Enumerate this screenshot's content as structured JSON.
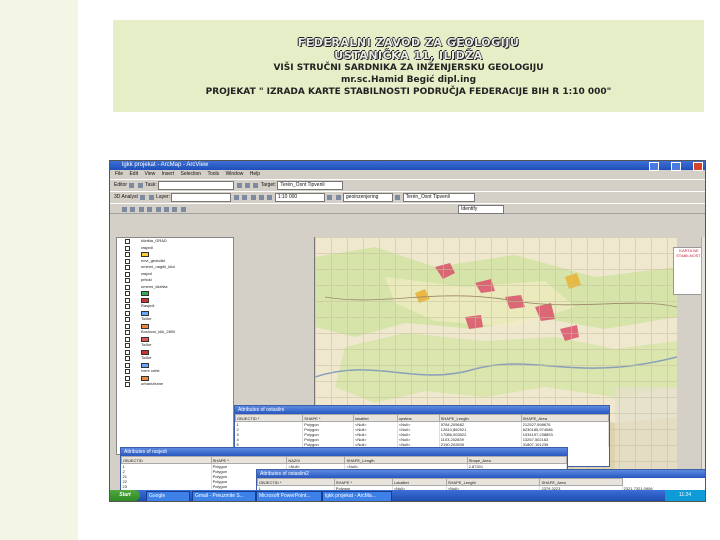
{
  "slide": {
    "title_line1": "FEDERALNI ZAVOD ZA GEOLOGIJU",
    "title_line2": "USTANIČKA 11, ILIDŽA",
    "subtitle_line1": "VIŠI STRUČNI SARDNIKA ZA INŽENJERSKU GEOLOGIJU",
    "subtitle_line2": "mr.sc.Hamid Begić dipl.ing",
    "subtitle_line3": "PROJEKAT \" IZRADA KARTE STABILNOSTI PODRUČJA FEDERACIJE BIH R 1:10 000\""
  },
  "app": {
    "window_title": "lgkk projekat - ArcMap - ArcView",
    "menu": [
      "File",
      "Edit",
      "View",
      "Insert",
      "Selection",
      "Tools",
      "Window",
      "Help"
    ],
    "toolbar_editor": "Editor",
    "toolbar_task": "Task:",
    "toolbar_target": "Target:",
    "toolbar_target_value": "Terén_Osnt Tipvenli",
    "toolbar_analyst": "3D Analyst",
    "toolbar_layer": "Layer:",
    "toolbar_layer_value": "geoinzenjering",
    "scale_value": "1:10 000",
    "tool_dropdown": "Identify"
  },
  "toc": {
    "items": [
      "klizišta_GRAD",
      "rasjedi",
      "",
      "novi_geološki",
      "umerni_nagibi_klizi",
      "rasjed",
      "pritoki",
      "umerni_klizišta",
      "",
      "",
      "Rasjedi",
      "",
      "Točke",
      "",
      "Boslovni_klik_2800",
      "",
      "Točke",
      "",
      "Točke",
      "",
      "Ivere cefst",
      "",
      "urbanizirane"
    ]
  },
  "map": {
    "right_panel_text": "KARTA NE STABILNOSTI"
  },
  "attr1": {
    "title": "Attributes of ostaslini",
    "columns": [
      "OBJECTID *",
      "SHAPE *",
      "lokalitet",
      "opstina",
      "SHAPE_Length",
      "SHAPE_Area"
    ],
    "rows": [
      [
        "1",
        "Polygon",
        "<Null>",
        "<Null>",
        "5784,205682",
        "212527,598676"
      ],
      [
        "2",
        "Polygon",
        "<Null>",
        "<Null>",
        "12810,862921",
        "6230185,974086"
      ],
      [
        "3",
        "Polygon",
        "<Null>",
        "<Null>",
        "17086,003522",
        "1034197,238893"
      ],
      [
        "4",
        "Polygon",
        "<Null>",
        "<Null>",
        "1103,202839",
        "13267,502163"
      ],
      [
        "5",
        "Polygon",
        "<Null>",
        "<Null>",
        "2190,202839",
        "31807,101239"
      ]
    ]
  },
  "attr2": {
    "title": "Attributes of rasjedi",
    "columns": [
      "OBJECTID",
      "SHAPE *",
      "NAZIV",
      "SHAPE_Length",
      "Shape_Area"
    ],
    "rows": [
      [
        "1",
        "Polygon",
        "<Null>",
        "<Null>",
        "2.87301"
      ],
      [
        "2",
        "Polygon",
        "<Null>",
        "<Null>",
        "4.0621"
      ],
      [
        "21",
        "Polygon",
        "<Null>",
        "<Null>",
        "22104"
      ],
      [
        "22",
        "Polygon",
        "<Null>",
        "<Null>",
        "19812"
      ],
      [
        "23",
        "Polygon",
        "<Null>",
        "<Null>",
        "8120"
      ]
    ]
  },
  "attr3": {
    "title": "Attributes of ostaslini2",
    "columns": [
      "OBJECTID *",
      "SHAPE *",
      "Lokalitet",
      "SHAPE_Length",
      "SHAPE_Area"
    ],
    "rows": [
      [
        "1",
        "Polygon",
        "<Null>",
        "<Null>",
        "2379,3223",
        "2321,7321.0906"
      ],
      [
        "2",
        "Polygon",
        "<Null>",
        "<Null>",
        "",
        ""
      ]
    ]
  },
  "taskbar": {
    "start": "Start",
    "buttons": [
      "Gmail - Preuzmite S...",
      "Microsoft PowerPoint...",
      "lgkk projekat - ArcMa...",
      "Google"
    ],
    "clock": "11:24"
  }
}
